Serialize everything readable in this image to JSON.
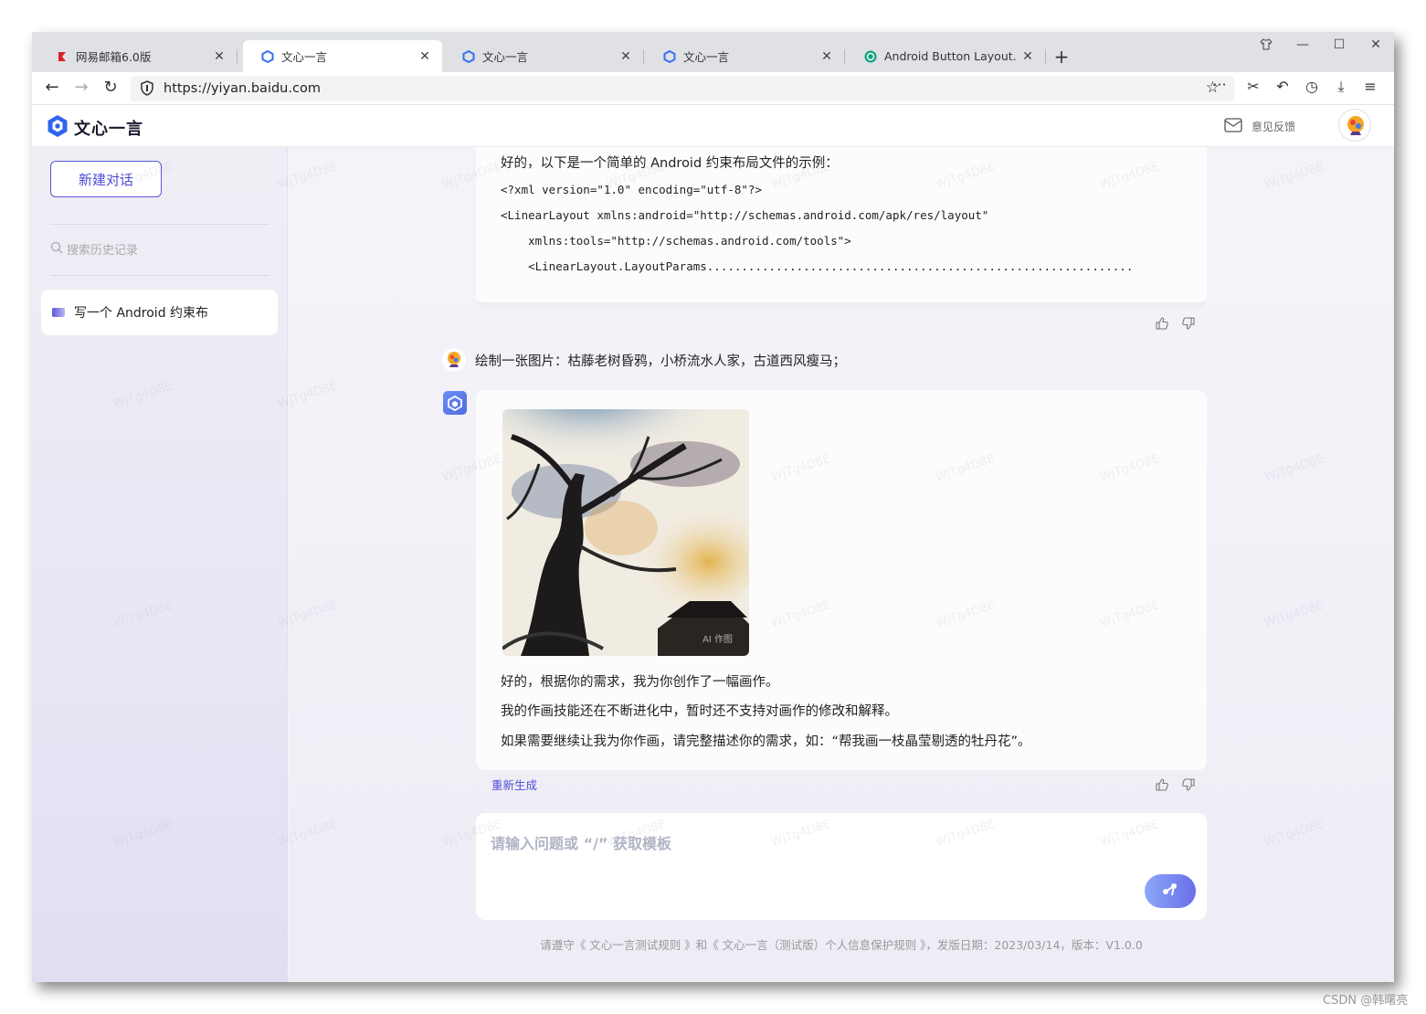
{
  "browser": {
    "tabs": [
      {
        "title": "网易邮箱6.0版",
        "icon": "netease-mail-icon",
        "active": false
      },
      {
        "title": "文心一言",
        "icon": "wenxin-icon",
        "active": true
      },
      {
        "title": "文心一言",
        "icon": "wenxin-icon",
        "active": false
      },
      {
        "title": "文心一言",
        "icon": "wenxin-icon",
        "active": false
      },
      {
        "title": "Android Button Layout.",
        "icon": "openai-icon",
        "active": false
      }
    ],
    "url": "https://yiyan.baidu.com"
  },
  "app": {
    "logo_text": "文心一言",
    "feedback_label": "意见反馈"
  },
  "sidebar": {
    "new_chat_label": "新建对话",
    "search_placeholder": "搜索历史记录",
    "history": [
      {
        "label": "写一个 Android 约束布"
      }
    ]
  },
  "chat": {
    "reply1": {
      "intro": "好的，以下是一个简单的 Android 约束布局文件的示例：",
      "code": [
        "<?xml version=\"1.0\" encoding=\"utf-8\"?>",
        "<LinearLayout xmlns:android=\"http://schemas.android.com/apk/res/layout\"",
        "    xmlns:tools=\"http://schemas.android.com/tools\">",
        "    <LinearLayout.LayoutParams.............................................................."
      ]
    },
    "user_message": "绘制一张图片：枯藤老树昏鸦，小桥流水人家，古道西风瘦马；",
    "reply2": {
      "image_watermark": "AI 作图",
      "lines": [
        "好的，根据你的需求，我为你创作了一幅画作。",
        "我的作画技能还在不断进化中，暂时还不支持对画作的修改和解释。",
        "如果需要继续让我为你作画，请完整描述你的需求，如：“帮我画一枝晶莹剔透的牡丹花”。"
      ]
    },
    "regenerate_label": "重新生成"
  },
  "input": {
    "placeholder": "请输入问题或 “/” 获取模板"
  },
  "footer": {
    "text": "请遵守《 文心一言测试规则 》和《 文心一言（测试版）个人信息保护规则 》，发版日期：2023/03/14，版本：V1.0.0"
  },
  "page_watermark": "WjTg4D8E",
  "csdn_watermark": "CSDN @韩曙亮",
  "colors": {
    "accent": "#4e4ad6",
    "sidebar_bg": "#e9e6f5",
    "send_button": "#6a6ee8"
  }
}
